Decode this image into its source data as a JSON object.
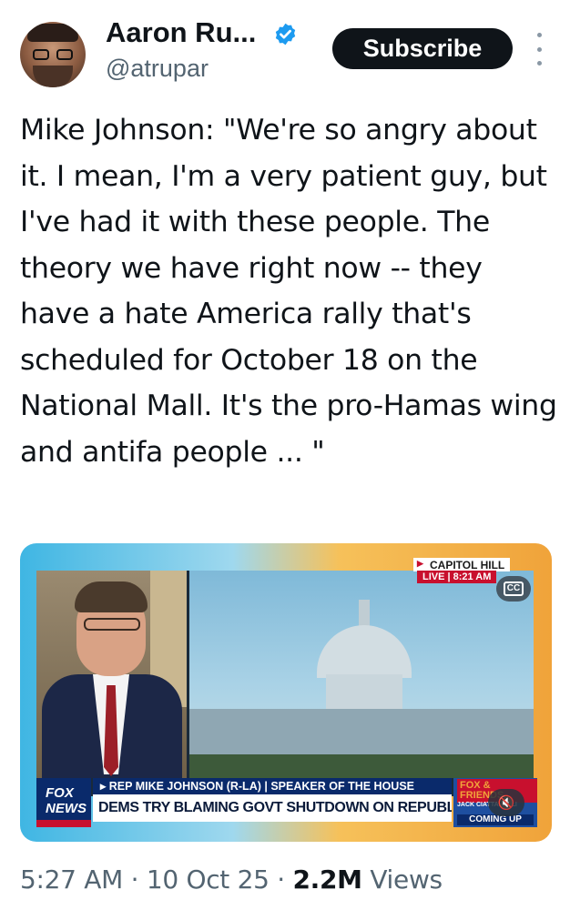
{
  "author": {
    "name": "Aaron Ru...",
    "handle": "@atrupar"
  },
  "actions": {
    "subscribe_label": "Subscribe"
  },
  "tweet": {
    "text": "Mike Johnson: \"We're so angry about it. I mean, I'm a very patient guy, but I've had it with these people. The theory we have right now -- they have a hate America rally that's scheduled for October 18 on the National Mall. It's the pro-Hamas wing and antifa people ... \""
  },
  "video": {
    "location_tag": "CAPITOL HILL",
    "live_tag": "LIVE | 8:21 AM",
    "cc_label": "CC",
    "network_logo": "FOX NEWS",
    "lower_third_top": "▸ REP MIKE JOHNSON (R-LA) | SPEAKER OF THE HOUSE",
    "lower_third_bottom": "DEMS TRY BLAMING GOVT SHUTDOWN ON REPUBLICANS",
    "show_logo": "FOX & FRIENDS",
    "next_guest": "JACK CIATTARELLI",
    "coming_up": "COMING UP"
  },
  "meta": {
    "time": "5:27 AM",
    "date": "10 Oct 25",
    "views_count": "2.2M",
    "views_label": "Views",
    "separator": "·"
  },
  "colors": {
    "accent_verified": "#1d9bf0",
    "button_bg": "#0f1419",
    "secondary_text": "#536471"
  }
}
